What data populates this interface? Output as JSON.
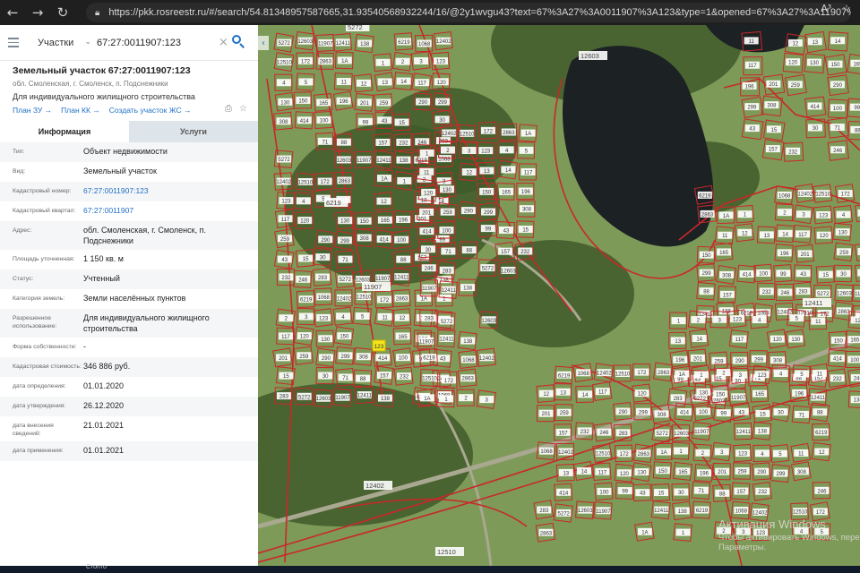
{
  "browser": {
    "url_host": "https://pkk.rosreestr.ru",
    "url_rest": "/#/search/54.81348957587665,31.93540568932244/16/@2y1wvgu43?text=67%3A27%3A0011907%3A123&type=1&opened=67%3A27%3A11907%3A123",
    "back_icon": "arrow-left-icon",
    "forward_icon": "arrow-right-icon",
    "reload_icon": "reload-icon",
    "read_aloud": "A³",
    "favorite_icon": "favorite-icon"
  },
  "search": {
    "type_label": "Участки",
    "query": "67:27:0011907:123"
  },
  "object": {
    "title": "Земельный участок 67:27:0011907:123",
    "address_short": "обл. Смоленская, г. Смоленск, п. Подснежники",
    "use": "Для индивидуального жилищного строительства",
    "actions": {
      "plan_zu": "План ЗУ →",
      "plan_kk": "План КК →",
      "create_js": "Создать участок ЖС →"
    }
  },
  "tabs": {
    "info": "Информация",
    "services": "Услуги"
  },
  "info_rows": [
    {
      "label": "Тип:",
      "value": "Объект недвижимости"
    },
    {
      "label": "Вид:",
      "value": "Земельный участок"
    },
    {
      "label": "Кадастровый номер:",
      "value": "67:27:0011907:123"
    },
    {
      "label": "Кадастровый квартал:",
      "value": "67:27:0011907"
    },
    {
      "label": "Адрес:",
      "value": "обл. Смоленская, г. Смоленск, п. Подснежники"
    },
    {
      "label": "Площадь уточненная:",
      "value": "1 150 кв. м"
    },
    {
      "label": "Статус:",
      "value": "Учтенный"
    },
    {
      "label": "Категория земель:",
      "value": "Земли населённых пунктов"
    },
    {
      "label": "Разрешенное использование:",
      "value": "Для индивидуального жилищного строительства"
    },
    {
      "label": "Форма собственности:",
      "value": "-"
    },
    {
      "label": "Кадастровая стоимость:",
      "value": "346 886 руб."
    },
    {
      "label": "дата определения:",
      "value": "01.01.2020"
    },
    {
      "label": "дата утверждения:",
      "value": "26.12.2020"
    },
    {
      "label": "дата внесения сведений:",
      "value": "21.01.2021"
    },
    {
      "label": "дата применения:",
      "value": "01.01.2021"
    }
  ],
  "map": {
    "labels": [
      "5272",
      "12603",
      "11907",
      "12411",
      "138",
      "6219",
      "1068",
      "12402",
      "12510",
      "172",
      "2863",
      "1А",
      "1",
      "2",
      "3",
      "123",
      "4",
      "5",
      "11",
      "12",
      "13",
      "14",
      "117",
      "120",
      "130",
      "150",
      "165",
      "196",
      "201",
      "259",
      "290",
      "299",
      "308",
      "414",
      "100",
      "99",
      "43",
      "15",
      "30",
      "71",
      "88",
      "157",
      "232",
      "246",
      "283"
    ],
    "colors": {
      "boundary": "#c8282a",
      "label_bg": "#ffffff",
      "selected": "#f4e41c",
      "water": "#1c2124",
      "forest": "#3f5a2a",
      "field": "#7e9a58",
      "road": "#a9a890"
    }
  },
  "watermark": {
    "line1": "Активация Windows",
    "line2": "Чтобы активировать Windows, пере",
    "line3": "Параметры."
  },
  "taskbar": {
    "search_label": "Стопто"
  }
}
